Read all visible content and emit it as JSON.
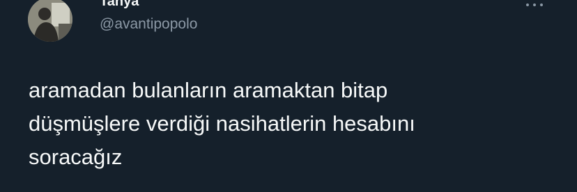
{
  "tweet": {
    "display_name": "Tanya",
    "handle": "@avantipopolo",
    "text": "aramadan bulanların aramaktan bitap\ndüşmüşlere verdiği nasihatlerin hesabını\nsoracağız",
    "more_icon": "more-horizontal-icon",
    "avatar_icon": "profile-photo"
  },
  "colors": {
    "background": "#15202b",
    "text_primary": "#f7f9f9",
    "text_secondary": "#8b98a5"
  }
}
